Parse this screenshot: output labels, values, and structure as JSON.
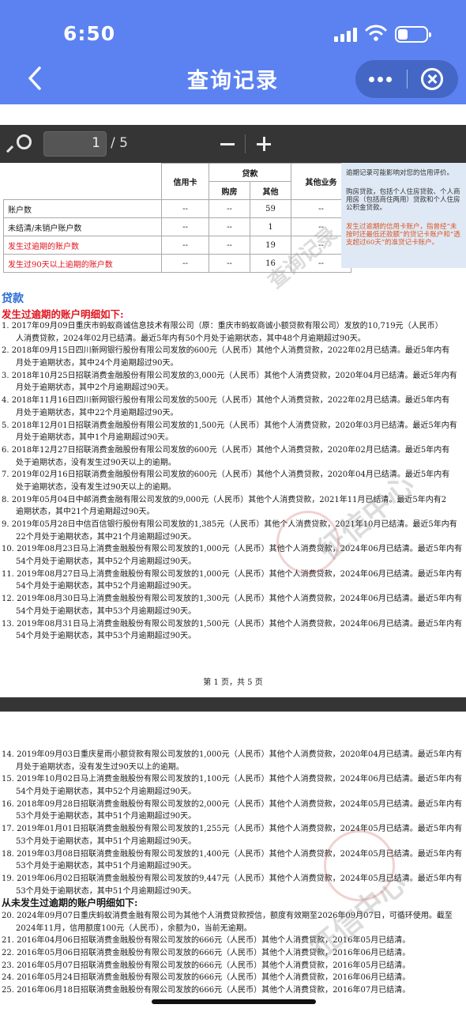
{
  "status_bar": {
    "time": "6:50"
  },
  "header": {
    "title": "查询记录"
  },
  "viewer": {
    "current_page": "1",
    "total": "/ 5"
  },
  "summary_table": {
    "columns": {
      "credit_card": "信用卡",
      "loan": "贷款",
      "housing": "购房",
      "other": "其他",
      "other_biz": "其他业务"
    },
    "rows": [
      {
        "label": "账户数",
        "credit": "--",
        "housing": "--",
        "other": "59",
        "biz": "--"
      },
      {
        "label": "未结清/未销户账户数",
        "credit": "--",
        "housing": "--",
        "other": "1",
        "biz": "--"
      },
      {
        "label": "发生过逾期的账户数",
        "credit": "--",
        "housing": "--",
        "other": "19",
        "biz": "--"
      },
      {
        "label": "发生过90天以上逾期的账户数",
        "credit": "--",
        "housing": "--",
        "other": "16",
        "biz": "--"
      }
    ]
  },
  "notes": [
    "逾期记录可能影响对您的信用评价。",
    "购房贷款，包括个人住房贷款、个人商用房（包括商住两用）贷款和个人住房公积金贷款。",
    "发生过逾期的信用卡账户，指曾经“未按时还最低还款额”的贷记卡账户和“透支超过60天”的准贷记卡账户。"
  ],
  "section": {
    "title": "贷款",
    "overdue_header": "发生过逾期的账户明细如下:"
  },
  "page1_lines": [
    {
      "t": "1.  2017年09月09日重庆市蚂蚁商诚信息技术有限公司（原：重庆市蚂蚁商诚小额贷款有限公司）发放的10,719元（人民币）",
      "c": false
    },
    {
      "t": "人消费贷款，2024年02月已结清。最近5年内有50个月处于逾期状态，其中48个月逾期超过90天。",
      "c": true
    },
    {
      "t": "2.  2018年09月15日四川新网银行股份有限公司发放的600元（人民币）其他个人消费贷款，2022年02月已结清。最近5年内有",
      "c": false
    },
    {
      "t": "月处于逾期状态，其中24个月逾期超过90天。",
      "c": true
    },
    {
      "t": "3.  2018年10月25日招联消费金融股份有限公司发放的3,000元（人民币）其他个人消费贷款，2020年04月已结清。最近5年内有",
      "c": false
    },
    {
      "t": "月处于逾期状态，其中2个月逾期超过90天。",
      "c": true
    },
    {
      "t": "4.  2018年11月16日四川新网银行股份有限公司发放的500元（人民币）其他个人消费贷款，2022年02月已结清。最近5年内有",
      "c": false
    },
    {
      "t": "月处于逾期状态，其中22个月逾期超过90天。",
      "c": true
    },
    {
      "t": "5.  2018年12月01日招联消费金融股份有限公司发放的1,500元（人民币）其他个人消费贷款，2020年03月已结清。最近5年内有",
      "c": false
    },
    {
      "t": "月处于逾期状态，其中1个月逾期超过90天。",
      "c": true
    },
    {
      "t": "6.  2018年12月27日招联消费金融股份有限公司发放的600元（人民币）其他个人消费贷款，2020年02月已结清。最近5年内有",
      "c": false
    },
    {
      "t": "处于逾期状态，没有发生过90天以上的逾期。",
      "c": true
    },
    {
      "t": "7.  2019年02月16日招联消费金融股份有限公司发放的600元（人民币）其他个人消费贷款，2020年04月已结清。最近5年内有",
      "c": false
    },
    {
      "t": "处于逾期状态，没有发生过90天以上的逾期。",
      "c": true
    },
    {
      "t": "8.  2019年05月04日中邮消费金融有限公司发放的9,000元（人民币）其他个人消费贷款，2021年11月已结清。最近5年内有2",
      "c": false
    },
    {
      "t": "逾期状态，其中21个月逾期超过90天。",
      "c": true
    },
    {
      "t": "9.  2019年05月28日中信百信银行股份有限公司发放的1,385元（人民币）其他个人消费贷款，2021年10月已结清。最近5年内有",
      "c": false
    },
    {
      "t": "22个月处于逾期状态，其中21个月逾期超过90天。",
      "c": true
    },
    {
      "t": "10. 2019年08月23日马上消费金融股份有限公司发放的1,000元（人民币）其他个人消费贷款，2024年06月已结清。最近5年内有",
      "c": false
    },
    {
      "t": "54个月处于逾期状态，其中52个月逾期超过90天。",
      "c": true
    },
    {
      "t": "11. 2019年08月27日马上消费金融股份有限公司发放的1,000元（人民币）其他个人消费贷款，2024年06月已结清。最近5年内有",
      "c": false
    },
    {
      "t": "54个月处于逾期状态，其中52个月逾期超过90天。",
      "c": true
    },
    {
      "t": "12. 2019年08月30日马上消费金融股份有限公司发放的1,300元（人民币）其他个人消费贷款，2024年06月已结清。最近5年内有",
      "c": false
    },
    {
      "t": "54个月处于逾期状态，其中53个月逾期超过90天。",
      "c": true
    },
    {
      "t": "13. 2019年08月31日马上消费金融股份有限公司发放的1,500元（人民币）其他个人消费贷款，2024年06月已结清。最近5年内有",
      "c": false
    },
    {
      "t": "54个月处于逾期状态，其中53个月逾期超过90天。",
      "c": true
    }
  ],
  "page_footer": "第 1 页，共 5 页",
  "page2_lines": [
    {
      "t": "14. 2019年09月03日重庆星雨小额贷款有限公司发放的1,000元（人民币）其他个人消费贷款，2020年04月已结清。最近5年内有",
      "c": false
    },
    {
      "t": "月处于逾期状态，没有发生过90天以上的逾期。",
      "c": true
    },
    {
      "t": "15. 2019年10月02日马上消费金融股份有限公司发放的1,100元（人民币）其他个人消费贷款，2024年06月已结清。最近5年内有",
      "c": false
    },
    {
      "t": "54个月处于逾期状态，其中52个月逾期超过90天。",
      "c": true
    },
    {
      "t": "16. 2018年09月28日招联消费金融股份有限公司发放的2,000元（人民币）其他个人消费贷款，2024年05月已结清。最近5年内有",
      "c": false
    },
    {
      "t": "53个月处于逾期状态，其中51个月逾期超过90天。",
      "c": true
    },
    {
      "t": "17. 2019年01月01日招联消费金融股份有限公司发放的1,255元（人民币）其他个人消费贷款，2024年05月已结清。最近5年内有",
      "c": false
    },
    {
      "t": "53个月处于逾期状态，其中51个月逾期超过90天。",
      "c": true
    },
    {
      "t": "18. 2019年03月08日招联消费金融股份有限公司发放的1,400元（人民币）其他个人消费贷款，2024年05月已结清。最近5年内有",
      "c": false
    },
    {
      "t": "53个月处于逾期状态，其中51个月逾期超过90天。",
      "c": true
    },
    {
      "t": "19. 2019年06月02日招联消费金融股份有限公司发放的9,447元（人民币）其他个人消费贷款，2024年05月已结清。最近5年内有",
      "c": false
    },
    {
      "t": "53个月处于逾期状态，其中51个月逾期超过90天。",
      "c": true
    }
  ],
  "never_overdue_header": "从未发生过逾期的账户明细如下:",
  "page2_lines_b": [
    {
      "t": "20. 2024年09月07日重庆蚂蚁消费金融有限公司为其他个人消费贷款授信，额度有效期至2026年09月07日，可循环使用。截至",
      "c": false
    },
    {
      "t": "2024年11月，信用额度100元（人民币），余额为0，当前无逾期。",
      "c": true
    },
    {
      "t": "21. 2016年04月06日招联消费金融股份有限公司发放的666元（人民币）其他个人消费贷款，2016年05月已结清。",
      "c": false
    },
    {
      "t": "22. 2016年05月06日招联消费金融股份有限公司发放的666元（人民币）其他个人消费贷款，2016年06月已结清。",
      "c": false
    },
    {
      "t": "23. 2016年05月07日招联消费金融股份有限公司发放的666元（人民币）其他个人消费贷款，2016年05月已结清。",
      "c": false
    },
    {
      "t": "24. 2016年05月24日招联消费金融股份有限公司发放的666元（人民币）其他个人消费贷款，2016年06月已结清。",
      "c": false
    },
    {
      "t": "25. 2016年06月18日招联消费金融股份有限公司发放的666元（人民币）其他个人消费贷款，2016年07月已结清。",
      "c": false
    }
  ],
  "watermarks": [
    "征信中心",
    "查询记录"
  ]
}
